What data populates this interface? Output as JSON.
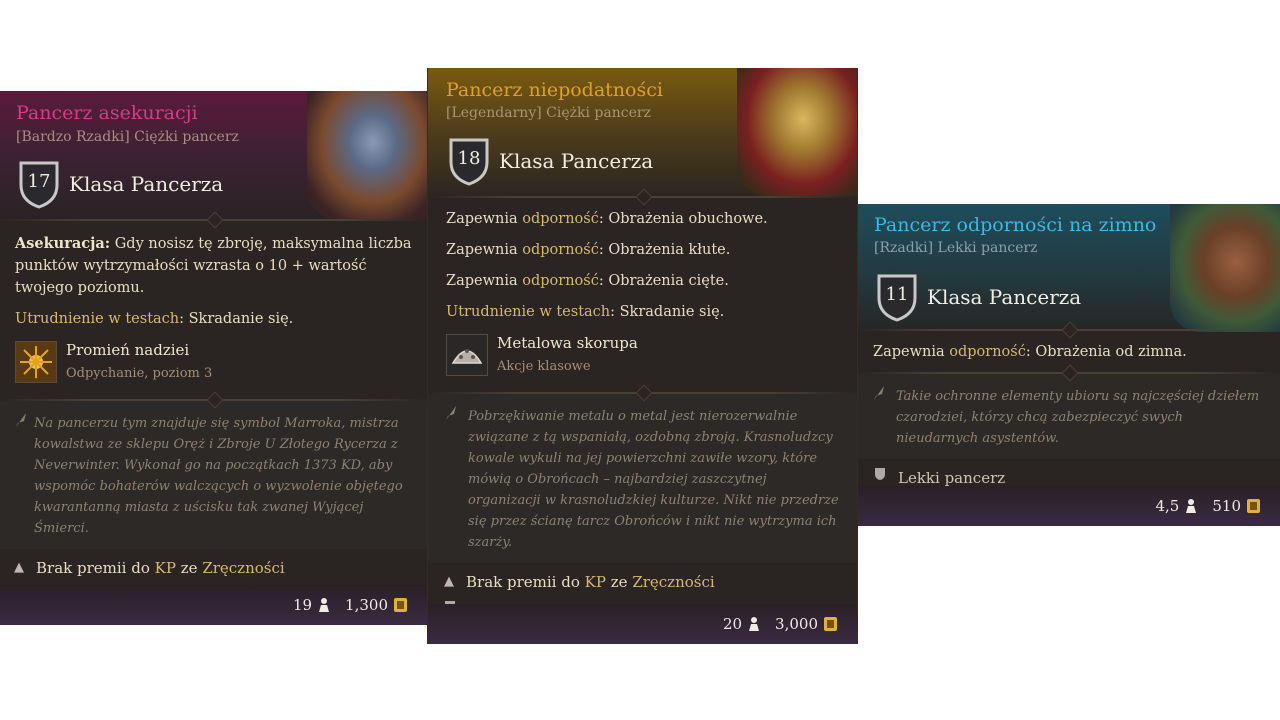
{
  "cards": [
    {
      "title": "Pancerz asekuracji",
      "subtitle": "[Bardzo Rzadki] Ciężki pancerz",
      "armor_class": "17",
      "armor_class_label": "Klasa Pancerza",
      "ability_name": "Asekuracja:",
      "ability_text": "Gdy nosisz tę zbroję, maksymalna liczba punktów wytrzymałości wzrasta o 10 + wartość twojego poziomu.",
      "disadvantage_a": "Utrudnienie w testach",
      "disadvantage_b": ": Skradanie się.",
      "spell_name": "Promień nadziei",
      "spell_sub": "Odpychanie, poziom 3",
      "spell_icon": "sun-rays-icon",
      "flavor": "Na pancerzu tym znajduje się symbol Marroka, mistrza kowalstwa ze sklepu Oręż i Zbroje U Złotego Rycerza z Neverwinter. Wykonał go na początkach 1373 KD, aby wspomóc bohaterów walczących o wyzwolenie objętego kwarantanną miasta z uścisku tak zwanej Wyjącej Śmierci.",
      "no_bonus_a": "Brak premii do ",
      "no_bonus_kp": "KP",
      "no_bonus_b": " ze ",
      "no_bonus_dex": "Zręczności",
      "armor_type": "Ciężki pancerz",
      "weight": "19",
      "value": "1,300",
      "title_color": "#d83a8a"
    },
    {
      "title": "Pancerz niepodatności",
      "subtitle": "[Legendarny] Ciężki pancerz",
      "armor_class": "18",
      "armor_class_label": "Klasa Pancerza",
      "res_prefix": "Zapewnia ",
      "res_kw": "odporność",
      "res_1": ": Obrażenia obuchowe.",
      "res_2": ": Obrażenia kłute.",
      "res_3": ": Obrażenia cięte.",
      "disadvantage_a": "Utrudnienie w testach",
      "disadvantage_b": ": Skradanie się.",
      "spell_name": "Metalowa skorupa",
      "spell_sub": "Akcje klasowe",
      "spell_icon": "shell-dome-icon",
      "flavor": "Pobrzękiwanie metalu o metal jest nierozerwalnie związane z tą wspaniałą, ozdobną zbroją. Krasnoludzcy kowale wykuli na jej powierzchni zawiłe wzory, które mówią o Obrońcach – najbardziej zaszczytnej organizacji w krasnoludzkiej kulturze. Nikt nie przedrze się przez ścianę tarcz Obrońców i nikt nie wytrzyma ich szarży.",
      "no_bonus_a": "Brak premii do ",
      "no_bonus_kp": "KP",
      "no_bonus_b": " ze ",
      "no_bonus_dex": "Zręczności",
      "armor_type": "Ciężki pancerz",
      "weight": "20",
      "value": "3,000",
      "title_color": "#e0a020"
    },
    {
      "title": "Pancerz odporności na zimno",
      "subtitle": "[Rzadki] Lekki pancerz",
      "armor_class": "11",
      "armor_class_label": "Klasa Pancerza",
      "res_prefix": "Zapewnia ",
      "res_kw": "odporność",
      "res_1": ": Obrażenia od zimna.",
      "flavor": "Takie ochronne elementy ubioru są najczęściej dziełem czarodziei, którzy chcą zabezpieczyć swych nieudarnych asystentów.",
      "armor_type": "Lekki pancerz",
      "weight": "4,5",
      "value": "510",
      "title_color": "#3ab8e8"
    }
  ]
}
